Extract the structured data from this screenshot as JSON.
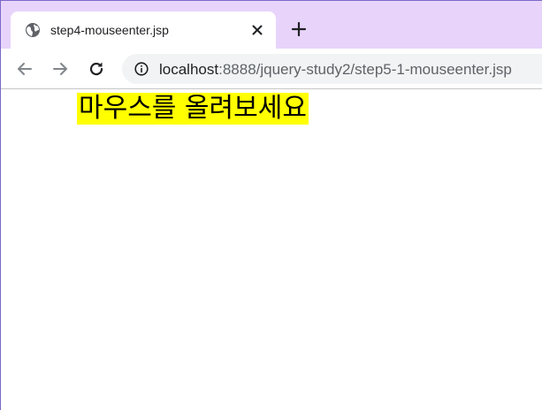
{
  "browser": {
    "tab": {
      "title": "step4-mouseenter.jsp",
      "favicon": "globe-icon",
      "close": "close-icon"
    },
    "new_tab": "plus-icon",
    "toolbar": {
      "back": "arrow-left-icon",
      "forward": "arrow-right-icon",
      "reload": "reload-icon",
      "site_info": "info-icon",
      "url_host": "localhost",
      "url_rest": ":8888/jquery-study2/step5-1-mouseenter.jsp"
    },
    "colors": {
      "tab_strip": "#e8d4fb",
      "omnibox": "#f1f3f4"
    }
  },
  "page": {
    "hover_text": "마우스를 올려보세요",
    "hover_background": "#ffff00"
  }
}
